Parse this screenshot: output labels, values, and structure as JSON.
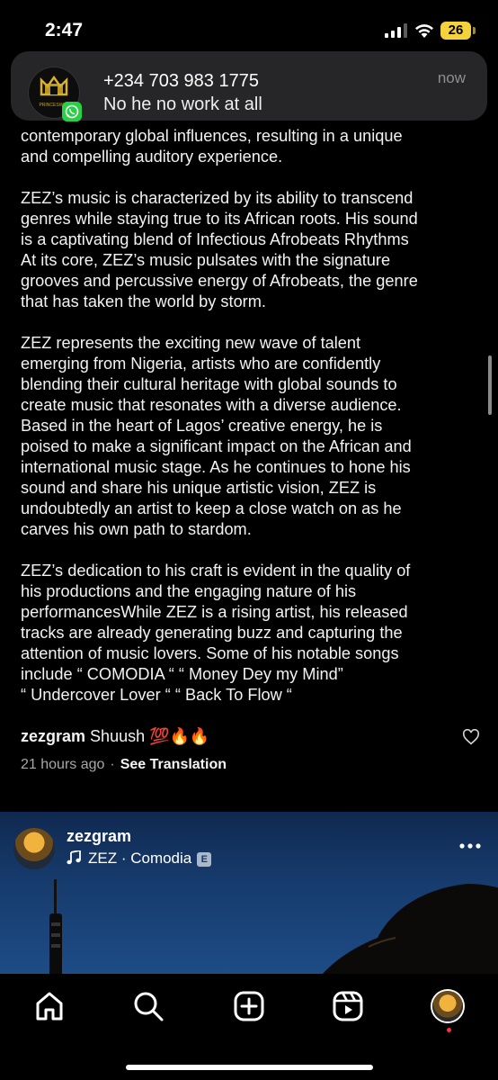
{
  "status_bar": {
    "time": "2:47",
    "battery": "26"
  },
  "notification": {
    "avatar_logo_text": "PRINCESWAY",
    "title": "+234 703 983 1775",
    "message": "No he no work at all",
    "time": "now",
    "app_icon": "whatsapp-icon"
  },
  "caption": {
    "paragraphs": [
      [
        "contemporary global influences, resulting in a unique",
        "and compelling auditory experience."
      ],
      [
        "ZEZ’s music is characterized by its ability to transcend",
        "genres while staying true to its African roots. His sound",
        "is a captivating blend of Infectious Afrobeats Rhythms",
        "At its core, ZEZ’s music pulsates with the signature",
        "grooves and percussive energy of Afrobeats, the genre",
        "that has taken the world by storm."
      ],
      [
        "ZEZ represents the exciting new wave of talent",
        "emerging from Nigeria, artists who are confidently",
        "blending their cultural heritage with global sounds to",
        "create music that resonates with a diverse audience.",
        "Based in the heart of Lagos’ creative energy, he is",
        "poised to make a significant impact on the African and",
        "international music stage. As he continues to hone his",
        "sound and share his unique artistic vision, ZEZ is",
        "undoubtedly an artist to keep a close watch on as he",
        "carves his own path to stardom."
      ],
      [
        "ZEZ’s dedication to his craft is evident in the quality of",
        "his productions and the engaging nature of his",
        "performancesWhile ZEZ is a rising artist, his released",
        "tracks are already generating buzz and capturing the",
        "attention of music lovers. Some of his notable songs",
        "include “ COMODIA “ “ Money Dey my Mind”",
        "“ Undercover Lover “ “ Back To Flow “"
      ]
    ]
  },
  "comment": {
    "username": "zezgram",
    "text": "Shuush 💯🔥🔥",
    "time_ago": "21 hours ago",
    "separator": "·",
    "see_translation": "See Translation"
  },
  "next_post": {
    "username": "zezgram",
    "music": "ZEZ · Comodia",
    "explicit": "E"
  },
  "bottom_nav": {
    "items": [
      "home-icon",
      "search-icon",
      "create-icon",
      "reels-icon",
      "profile-avatar"
    ]
  }
}
